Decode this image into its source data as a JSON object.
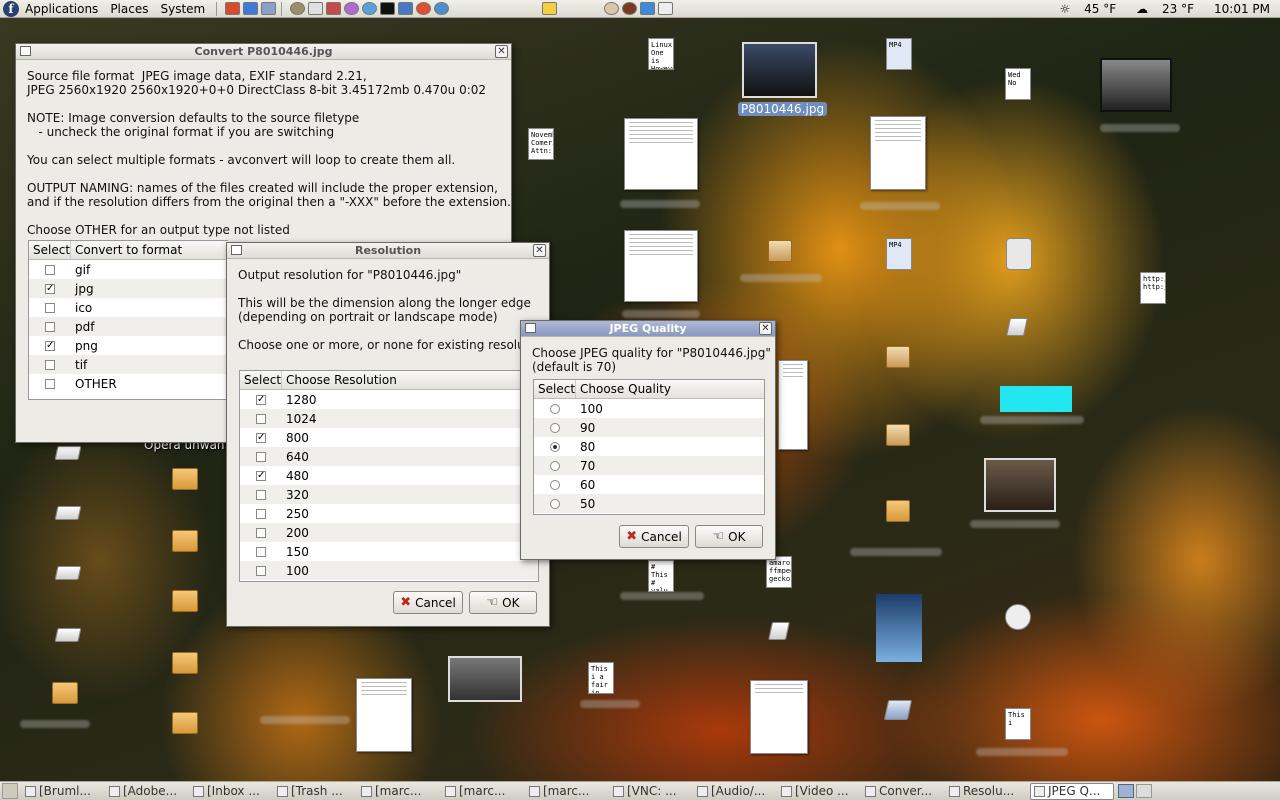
{
  "top_panel": {
    "menus": [
      "Applications",
      "Places",
      "System"
    ],
    "weather": "45 °F",
    "weather2": "23 °F",
    "clock": "10:01 PM"
  },
  "desktop": {
    "selected_icon_label": "P8010446.jpg",
    "opera_label": "Opera unwan"
  },
  "convert_window": {
    "title": "Convert P8010446.jpg",
    "intro": "Source file format  JPEG image data, EXIF standard 2.21,\nJPEG 2560x1920 2560x1920+0+0 DirectClass 8-bit 3.45172mb 0.470u 0:02\n\nNOTE: Image conversion defaults to the source filetype\n   - uncheck the original format if you are switching\n\nYou can select multiple formats - avconvert will loop to create them all.\n\nOUTPUT NAMING: names of the files created will include the proper extension,\nand if the resolution differs from the original then a \"-XXX\" before the extension.\n\nChoose OTHER for an output type not listed",
    "col_select": "Select",
    "col_format": "Convert to format",
    "formats": [
      {
        "label": "gif",
        "checked": false
      },
      {
        "label": "jpg",
        "checked": true
      },
      {
        "label": "ico",
        "checked": false
      },
      {
        "label": "pdf",
        "checked": false
      },
      {
        "label": "png",
        "checked": true
      },
      {
        "label": "tif",
        "checked": false
      },
      {
        "label": "OTHER",
        "checked": false
      }
    ]
  },
  "resolution_window": {
    "title": "Resolution",
    "intro": "Output resolution for \"P8010446.jpg\"\n\nThis will be the dimension along the longer edge\n(depending on portrait or landscape mode)\n\nChoose one or more, or none for existing resolut",
    "col_select": "Select",
    "col_res": "Choose Resolution",
    "resolutions": [
      {
        "label": "1280",
        "checked": true
      },
      {
        "label": "1024",
        "checked": false
      },
      {
        "label": "800",
        "checked": true
      },
      {
        "label": "640",
        "checked": false
      },
      {
        "label": "480",
        "checked": true
      },
      {
        "label": "320",
        "checked": false
      },
      {
        "label": "250",
        "checked": false
      },
      {
        "label": "200",
        "checked": false
      },
      {
        "label": "150",
        "checked": false
      },
      {
        "label": "100",
        "checked": false
      }
    ],
    "cancel": "Cancel",
    "ok": "OK"
  },
  "quality_window": {
    "title": "JPEG Quality",
    "intro": "Choose JPEG quality for \"P8010446.jpg\"\n(default is 70)",
    "col_select": "Select",
    "col_quality": "Choose Quality",
    "qualities": [
      {
        "label": "100",
        "selected": false
      },
      {
        "label": "90",
        "selected": false
      },
      {
        "label": "80",
        "selected": true
      },
      {
        "label": "70",
        "selected": false
      },
      {
        "label": "60",
        "selected": false
      },
      {
        "label": "50",
        "selected": false
      }
    ],
    "cancel": "Cancel",
    "ok": "OK"
  },
  "taskbar": [
    "[Bruml...",
    "[Adobe...",
    "[Inbox ...",
    "[Trash ...",
    "[marc...",
    "[marc...",
    "[marc...",
    "[VNC: ...",
    "[Audio/...",
    "[Video ...",
    "Conver...",
    "Resolu...",
    "JPEG Q..."
  ],
  "taskbar_active_index": 12
}
